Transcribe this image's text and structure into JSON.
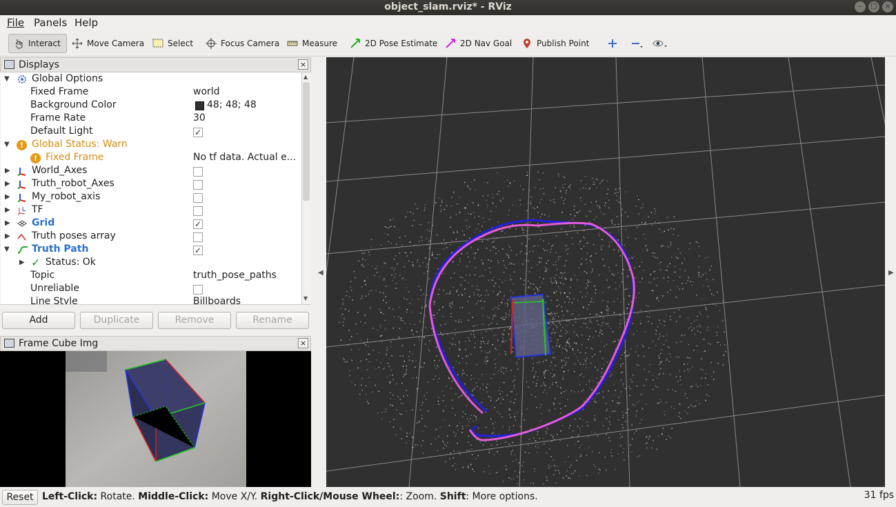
{
  "window": {
    "title": "object_slam.rviz* - RViz"
  },
  "menu": {
    "file": "File",
    "panels": "Panels",
    "help": "Help"
  },
  "toolbar": {
    "interact": "Interact",
    "move_camera": "Move Camera",
    "select": "Select",
    "focus_camera": "Focus Camera",
    "measure": "Measure",
    "pose_estimate": "2D Pose Estimate",
    "nav_goal": "2D Nav Goal",
    "publish_point": "Publish Point"
  },
  "displays": {
    "title": "Displays",
    "close": "×",
    "rows": [
      {
        "label": "Global Options"
      },
      {
        "label": "Fixed Frame",
        "value": "world"
      },
      {
        "label": "Background Color",
        "value": "48; 48; 48"
      },
      {
        "label": "Frame Rate",
        "value": "30"
      },
      {
        "label": "Default Light",
        "checked": true
      },
      {
        "label": "Global Status: Warn"
      },
      {
        "label": "Fixed Frame",
        "value": "No tf data.  Actual e..."
      },
      {
        "label": "World_Axes",
        "checked": false
      },
      {
        "label": "Truth_robot_Axes",
        "checked": false
      },
      {
        "label": "My_robot_axis",
        "checked": false
      },
      {
        "label": "TF",
        "checked": false
      },
      {
        "label": "Grid",
        "checked": true
      },
      {
        "label": "Truth poses array",
        "checked": false
      },
      {
        "label": "Truth Path",
        "checked": true
      },
      {
        "label": "Status: Ok"
      },
      {
        "label": "Topic",
        "value": "truth_pose_paths"
      },
      {
        "label": "Unreliable",
        "checked": false
      },
      {
        "label": "Line Style",
        "value": "Billboards"
      }
    ],
    "buttons": {
      "add": "Add",
      "duplicate": "Duplicate",
      "remove": "Remove",
      "rename": "Rename"
    }
  },
  "image_panel": {
    "title": "Frame Cube Img",
    "close": "×"
  },
  "status": {
    "reset": "Reset",
    "hint_parts": [
      "Left-Click:",
      " Rotate. ",
      "Middle-Click:",
      " Move X/Y. ",
      "Right-Click/Mouse Wheel:",
      ": Zoom. ",
      "Shift",
      ": More options."
    ],
    "fps": "31 fps"
  },
  "colors": {
    "background": "#303030",
    "warn": "#d38c12",
    "grid": "#a0a0a0",
    "truth_path": "#e45bd8",
    "est_path": "#1f1fe0"
  }
}
